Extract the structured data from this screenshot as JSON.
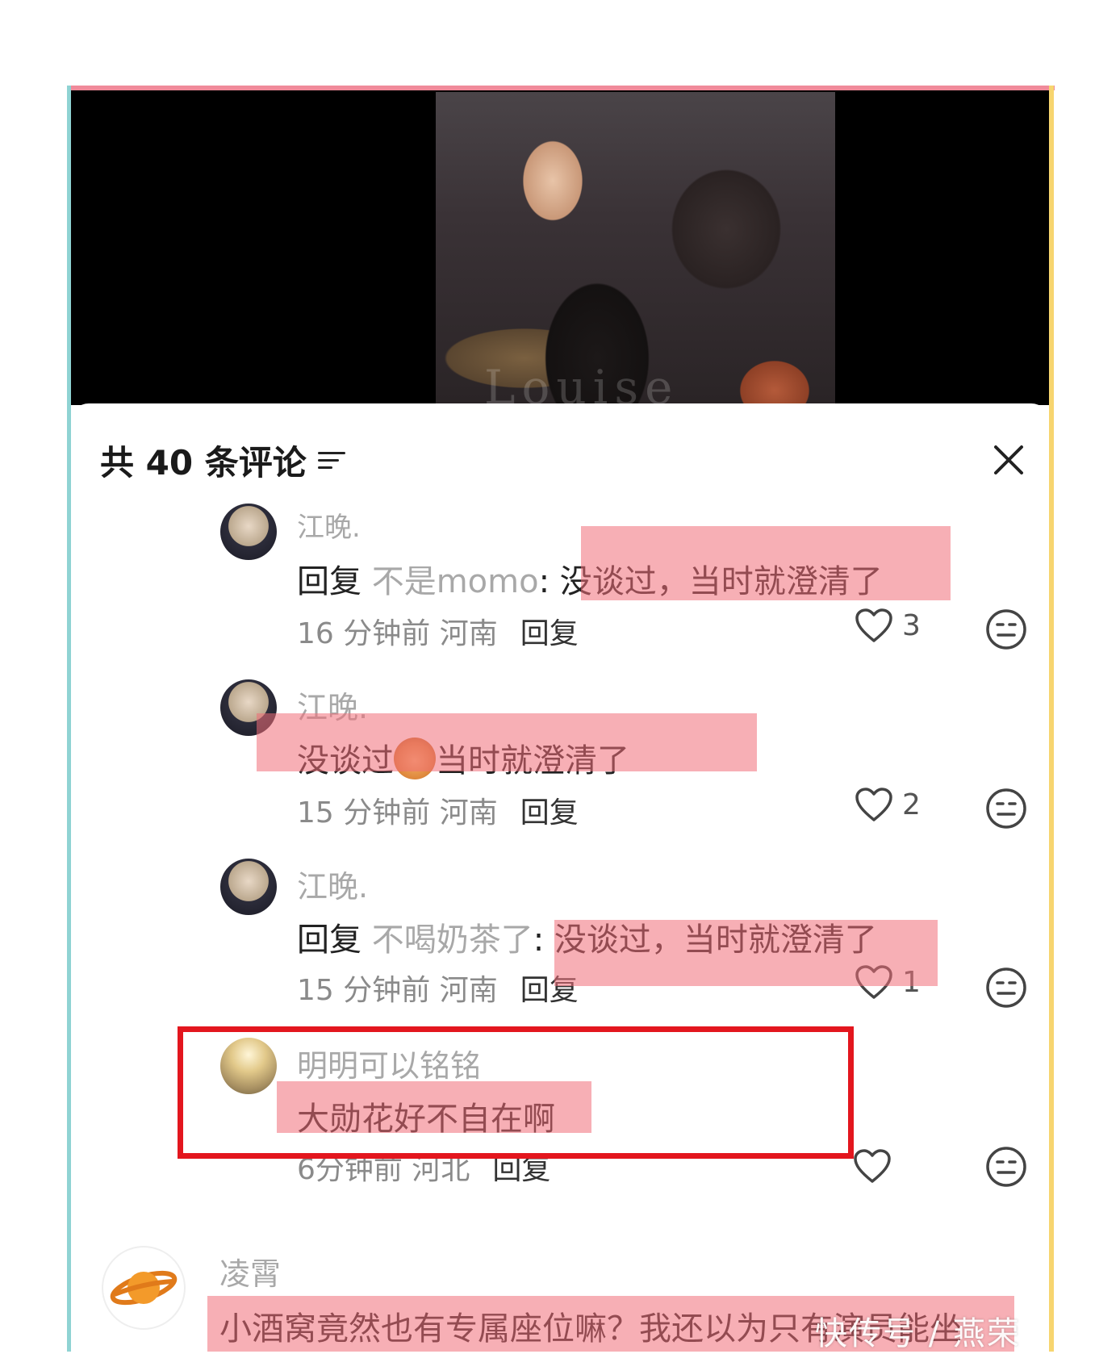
{
  "panel": {
    "title": "共 40 条评论"
  },
  "video": {
    "watermark": "Louise"
  },
  "comments": [
    {
      "username": "江晚.",
      "reply_prefix": "回复",
      "reply_target": "不是momo",
      "text": ": 没谈过，当时就澄清了",
      "time": "16 分钟前",
      "location": "河南",
      "reply_label": "回复",
      "likes": "3"
    },
    {
      "username": "江晚.",
      "text_before": "没谈过",
      "text_after": "当时就澄清了",
      "time": "15 分钟前",
      "location": "河南",
      "reply_label": "回复",
      "likes": "2"
    },
    {
      "username": "江晚.",
      "reply_prefix": "回复",
      "reply_target": "不喝奶茶了",
      "text": ": 没谈过，当时就澄清了",
      "time": "15 分钟前",
      "location": "河南",
      "reply_label": "回复",
      "likes": "1"
    },
    {
      "username": "明明可以铭铭",
      "text": "大勋花好不自在啊",
      "time": "6分钟前",
      "location": "河北",
      "reply_label": "回复"
    },
    {
      "username": "凌霄",
      "text": "小酒窝竟然也有专属座位嘛？我还以为只有演员能坐"
    }
  ],
  "watermark": "快传号 / 燕荣"
}
